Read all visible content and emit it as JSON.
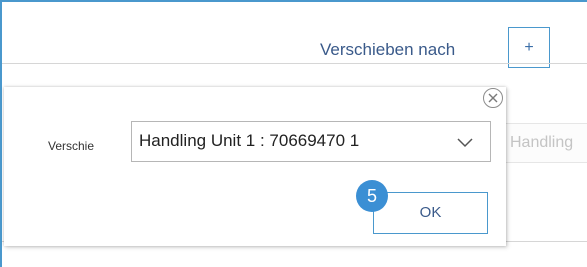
{
  "toolbar": {
    "move_to_label": "Verschieben nach",
    "add_label": "+"
  },
  "background_form": {
    "handling_unit_select_text": "Handling"
  },
  "popover": {
    "field_label": "Verschie",
    "handling_unit_select": {
      "selected_value": "Handling Unit 1 : 70669470 1"
    },
    "ok_label": "OK",
    "step_badge": "5",
    "icons": {
      "close": "close-icon",
      "dropdown": "chevron-down-icon"
    }
  },
  "colors": {
    "accent": "#4a98cd",
    "badge": "#3b8fd4",
    "link_text": "#3a5a8a"
  }
}
